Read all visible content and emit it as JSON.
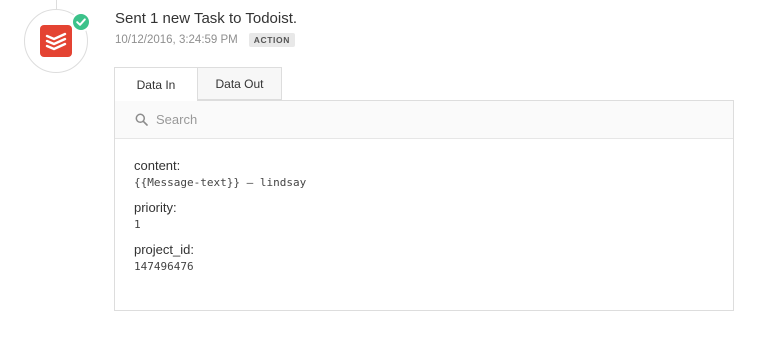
{
  "step": {
    "app_icon": "todoist-logo-icon",
    "status_icon": "check-icon",
    "title": "Sent 1 new Task to Todoist.",
    "timestamp": "10/12/2016, 3:24:59 PM",
    "badge": "ACTION"
  },
  "tabs": [
    {
      "label": "Data In",
      "active": true
    },
    {
      "label": "Data Out",
      "active": false
    }
  ],
  "search": {
    "icon": "search-icon",
    "placeholder": "Search",
    "value": ""
  },
  "fields": [
    {
      "key": "content:",
      "value": "{{Message-text}} – lindsay"
    },
    {
      "key": "priority:",
      "value": "1"
    },
    {
      "key": "project_id:",
      "value": "147496476"
    }
  ],
  "colors": {
    "todoist_red": "#e44332",
    "success_green": "#3cc28a",
    "border": "#dddddd"
  }
}
